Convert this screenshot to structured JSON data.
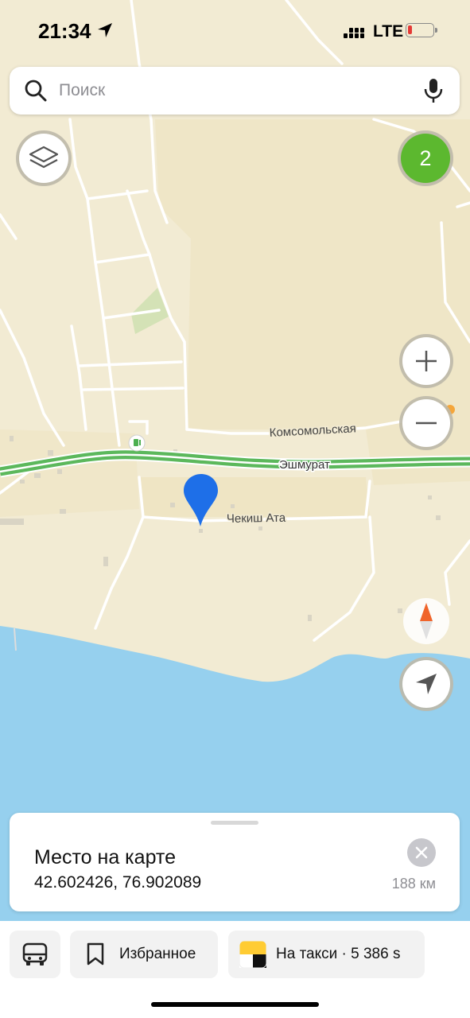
{
  "status_bar": {
    "time": "21:34",
    "network": "LTE"
  },
  "search": {
    "placeholder": "Поиск"
  },
  "map": {
    "labels": {
      "street_1": "Комсомольская",
      "street_2": "Эшмурат",
      "street_3": "Чекиш Ата"
    },
    "badge_count": "2"
  },
  "place_card": {
    "title": "Место на карте",
    "coordinates": "42.602426, 76.902089",
    "distance": "188 км"
  },
  "bottom_bar": {
    "favorites_label": "Избранное",
    "taxi_label": "На такси · 5 386 s"
  },
  "colors": {
    "land": "#f2ebd3",
    "water": "#96d0ee",
    "road": "#5cb85c",
    "pin": "#1e6fe8",
    "badge": "#5cb82f",
    "compass": "#f0642a"
  },
  "icons": [
    "location-arrow-icon",
    "search-icon",
    "mic-icon",
    "layers-icon",
    "plus-icon",
    "minus-icon",
    "compass-icon",
    "navigate-icon",
    "close-icon",
    "bus-icon",
    "bookmark-icon",
    "taxi-icon",
    "fuel-icon",
    "map-pin-icon"
  ]
}
